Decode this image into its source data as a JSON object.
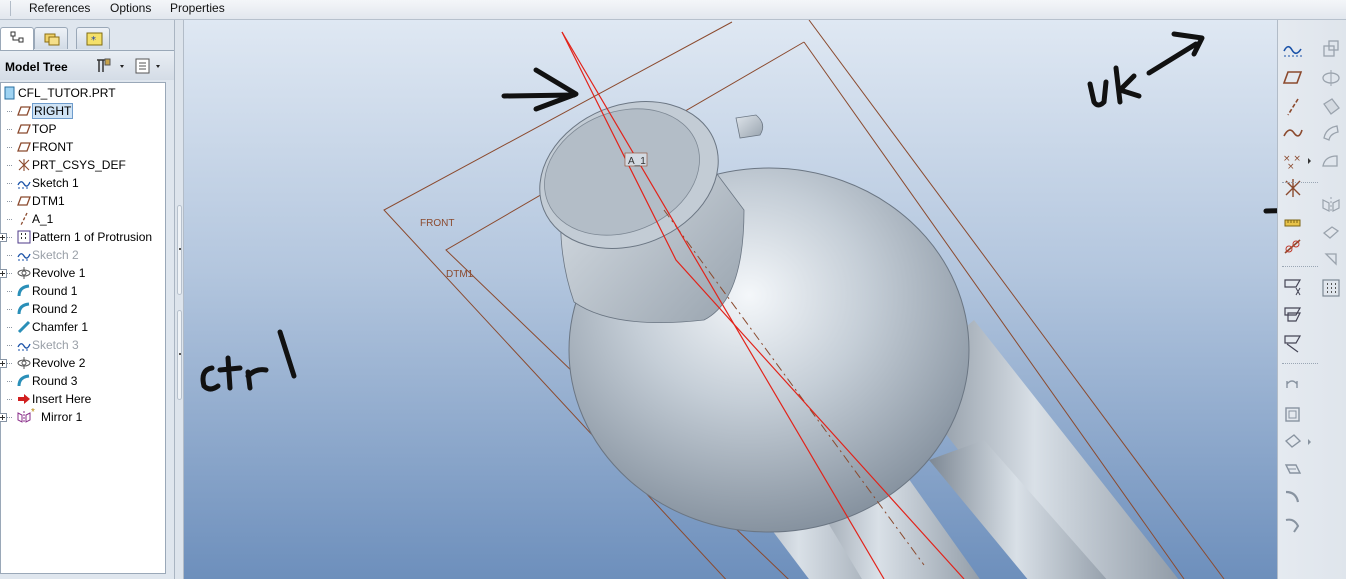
{
  "menu": [
    "References",
    "Options",
    "Properties"
  ],
  "navigator": {
    "title": "Model Tree",
    "tree": [
      {
        "label": "CFL_TUTOR.PRT",
        "icon": "part-icon",
        "level": 0,
        "expandable": false,
        "state": "normal"
      },
      {
        "label": "RIGHT",
        "icon": "datum-plane-icon",
        "level": 1,
        "expandable": false,
        "state": "selected"
      },
      {
        "label": "TOP",
        "icon": "datum-plane-icon",
        "level": 1,
        "expandable": false,
        "state": "normal"
      },
      {
        "label": "FRONT",
        "icon": "datum-plane-icon",
        "level": 1,
        "expandable": false,
        "state": "normal"
      },
      {
        "label": "PRT_CSYS_DEF",
        "icon": "csys-icon",
        "level": 1,
        "expandable": false,
        "state": "normal"
      },
      {
        "label": "Sketch 1",
        "icon": "sketch-icon",
        "level": 1,
        "expandable": false,
        "state": "normal"
      },
      {
        "label": "DTM1",
        "icon": "datum-plane-icon",
        "level": 1,
        "expandable": false,
        "state": "normal"
      },
      {
        "label": "A_1",
        "icon": "axis-icon",
        "level": 1,
        "expandable": false,
        "state": "normal"
      },
      {
        "label": "Pattern 1 of Protrusion",
        "icon": "pattern-icon",
        "level": 1,
        "expandable": true,
        "state": "normal"
      },
      {
        "label": "Sketch 2",
        "icon": "sketch-icon",
        "level": 1,
        "expandable": false,
        "state": "suppressed"
      },
      {
        "label": "Revolve 1",
        "icon": "revolve-icon",
        "level": 1,
        "expandable": true,
        "state": "normal"
      },
      {
        "label": "Round 1",
        "icon": "round-icon",
        "level": 1,
        "expandable": false,
        "state": "normal"
      },
      {
        "label": "Round 2",
        "icon": "round-icon",
        "level": 1,
        "expandable": false,
        "state": "normal"
      },
      {
        "label": "Chamfer 1",
        "icon": "chamfer-icon",
        "level": 1,
        "expandable": false,
        "state": "normal"
      },
      {
        "label": "Sketch 3",
        "icon": "sketch-icon",
        "level": 1,
        "expandable": false,
        "state": "suppressed"
      },
      {
        "label": "Revolve 2",
        "icon": "revolve-icon",
        "level": 1,
        "expandable": true,
        "state": "normal"
      },
      {
        "label": "Round 3",
        "icon": "round-icon",
        "level": 1,
        "expandable": false,
        "state": "normal"
      },
      {
        "label": "Insert Here",
        "icon": "insert-arrow-icon",
        "level": 1,
        "expandable": false,
        "state": "normal"
      },
      {
        "label": "Mirror 1",
        "icon": "mirror-icon",
        "level": 1,
        "expandable": true,
        "state": "normal"
      }
    ]
  },
  "viewport": {
    "datum_labels": {
      "front": "FRONT",
      "dtm1": "DTM1",
      "axis": "A_1"
    },
    "annotations": {
      "ok": "ok",
      "ctrl": "ctrl"
    }
  },
  "toolbar_right": {
    "column1": [
      "sketch-tool-icon",
      "datum-plane-tool-icon",
      "datum-axis-tool-icon",
      "datum-curve-tool-icon",
      "datum-point-tool-icon",
      "csys-tool-icon",
      "analysis-tool-icon",
      "datum-coordinate-icon",
      "copy-paste-icon",
      "merge-icon",
      "trim-icon",
      "extend-icon",
      "mirror-tool-icon",
      "solidify-icon",
      "offset-icon",
      "thicken-icon",
      "draft-icon",
      "round-tool-icon",
      "chamfer-tool-icon"
    ],
    "column2": [
      "hole-icon",
      "revolve-tool-icon",
      "rib-icon",
      "shell-icon",
      "sweep-icon",
      "mirror-feature-icon",
      "boundary-icon",
      "draft-feature-icon",
      "pattern-tool-icon"
    ]
  },
  "colors": {
    "datum": "#8b4a2e",
    "selection": "#e2231a",
    "viewport_bottom": "#6d8fbc"
  }
}
